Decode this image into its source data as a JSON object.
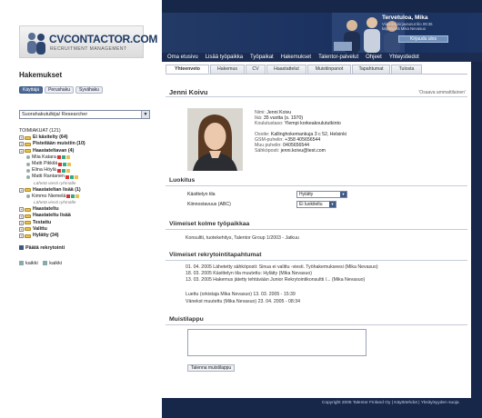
{
  "logo": {
    "name": "CVCONTACTOR.COM",
    "tagline": "RECRUITMENT MANAGEMENT"
  },
  "left": {
    "heading": "Hakemukset",
    "buttons": [
      "Käyttäjä",
      "Perushaku",
      "Syvähaku"
    ],
    "select_value": "Suorahakutulkija/ Researcher",
    "tree_title": "TOIMIAKUAT (121)",
    "tree": [
      {
        "label": "Ei käsitelty (64)",
        "bold": true,
        "indent": 0
      },
      {
        "label": "Pisteitään muistiin (10)",
        "bold": true,
        "indent": 0
      },
      {
        "label": "Haastateltavan (4)",
        "bold": true,
        "indent": 0
      },
      {
        "label": "Miia Katara",
        "bold": false,
        "indent": 1
      },
      {
        "label": "Matti Pikkilä",
        "bold": false,
        "indent": 1
      },
      {
        "label": "Elina Höylä",
        "bold": false,
        "indent": 1
      },
      {
        "label": "Matti Rantanen",
        "bold": false,
        "indent": 1
      },
      {
        "label": "Lähetä viesti ryhmälle",
        "bold": false,
        "indent": 2
      },
      {
        "label": "Haastateltan lisää (1)",
        "bold": true,
        "indent": 0
      },
      {
        "label": "Kimmo Niemelä",
        "bold": false,
        "indent": 1
      },
      {
        "label": "Lähetä viesti ryhmälle",
        "bold": false,
        "indent": 2
      },
      {
        "label": "Haastateltu",
        "bold": true,
        "indent": 0
      },
      {
        "label": "Haastateltu lisää",
        "bold": true,
        "indent": 0
      },
      {
        "label": "Testattu",
        "bold": true,
        "indent": 0
      },
      {
        "label": "Valittu",
        "bold": true,
        "indent": 0
      },
      {
        "label": "Hylätty (34)",
        "bold": true,
        "indent": 0
      }
    ],
    "link_main": "Päätä rekrytointi",
    "link_a": "kaikki",
    "link_b": "kaikki"
  },
  "header": {
    "user": "Tervetuloa, Mika",
    "info": "Viimeksi kirjautunut klo 09:36 käyttäjänä Mika Nevasuo",
    "logout": "Kirjaudu ulos"
  },
  "nav": [
    "Oma etusivu",
    "Lisää työpaikka",
    "Työpaikat",
    "Hakemukset",
    "Talentor-palvelut",
    "Ohjeet",
    "Yhteystiedot"
  ],
  "tabs": [
    "Yhteenveto",
    "Hakemus",
    "CV",
    "Haastattelut",
    "Muistiinpanot",
    "Tapahtumat",
    "Tulosta"
  ],
  "person": {
    "name": "Jenni Koivu",
    "tag": "'Osaava ammattilainen'",
    "rows": [
      {
        "k": "Nimi:",
        "v": "Jenni Koivu"
      },
      {
        "k": "Ikä:",
        "v": "35 vuotta (s. 1970)"
      },
      {
        "k": "Koulutustaso:",
        "v": "Ylempi korkeakoulututkinto"
      },
      {
        "k": "Osoite:",
        "v": "Kallinghokemankuja 3 c 52, Helsinki"
      },
      {
        "k": "GSM-puhelin:",
        "v": "+358 405656544"
      },
      {
        "k": "Muu puhelin:",
        "v": "0405656544"
      },
      {
        "k": "Sähköposti:",
        "v": "jenni.koivu@test.com"
      }
    ]
  },
  "luokitus": {
    "title": "Luokitus",
    "row1_label": "Käsittelyn tila",
    "row1_value": "Hylätty",
    "row2_label": "Kiinnostavuus (ABC)",
    "row2_value": "Ei luokiteltu"
  },
  "jobs": {
    "title": "Viimeiset kolme työpaikkaa",
    "line": "Konsultti, tuotekehitys, Talentor Group 1/2003 - Jatkuu"
  },
  "events": {
    "title": "Viimeiset rekrytointitapahtumat",
    "rows": [
      "01. 04. 2005   Lähetetty sähköposti: Sinua ei valittu -viesti. Työhakemukseesi (Mika Nevasuo)",
      "18. 03. 2005   Käsittelyn tila muutettu: Hylätty (Mika Nevasuo)",
      "13. 03. 2005   Hakemus jätetty tehtävään Junior Rekrytointikonsultti /... (Mika Nevasuo)"
    ],
    "read1": "Luettu (orkistaja Mika Nevasuo) 13. 03. 2005 - 15:39",
    "read2": "Vänekst muutettu (Mika Nevasuo) 23. 04. 2005 - 08:34"
  },
  "notes": {
    "title": "Muistilappu",
    "save": "Talenna muistilappu"
  },
  "footer": "Copyright 2005 Talentor Finland Oy   |   Käyttöehdot   |   Yksityisyyden suoja"
}
